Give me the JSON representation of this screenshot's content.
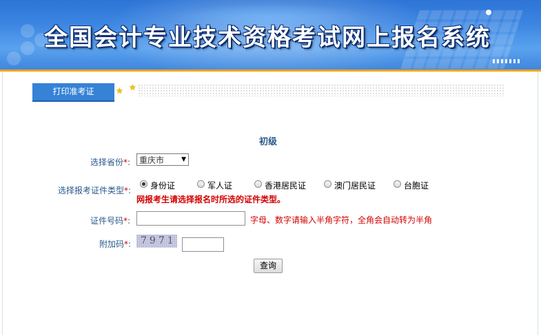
{
  "header": {
    "title": "全国会计专业技术资格考试网上报名系统"
  },
  "tabs": [
    {
      "label": "打印准考证"
    }
  ],
  "form": {
    "level": "初级",
    "province": {
      "label": "选择省份",
      "required": "*",
      "colon": ":",
      "value": "重庆市"
    },
    "id_type": {
      "label": "选择报考证件类型",
      "required": "*",
      "colon": ":",
      "options": [
        "身份证",
        "军人证",
        "香港居民证",
        "澳门居民证",
        "台胞证"
      ],
      "selected": "身份证",
      "warning": "网报考生请选择报名时所选的证件类型。"
    },
    "id_number": {
      "label": "证件号码",
      "required": "*",
      "colon": ":",
      "value": "",
      "hint": "字母、数字请输入半角字符，全角会自动转为半角"
    },
    "captcha": {
      "label": "附加码",
      "required": "*",
      "colon": ":",
      "image_text": "7971",
      "value": ""
    },
    "submit_label": "查询"
  },
  "colors": {
    "accent": "#3582d6",
    "banner_border": "#f0a400",
    "warning": "#d40000",
    "label": "#2a5a8a"
  }
}
